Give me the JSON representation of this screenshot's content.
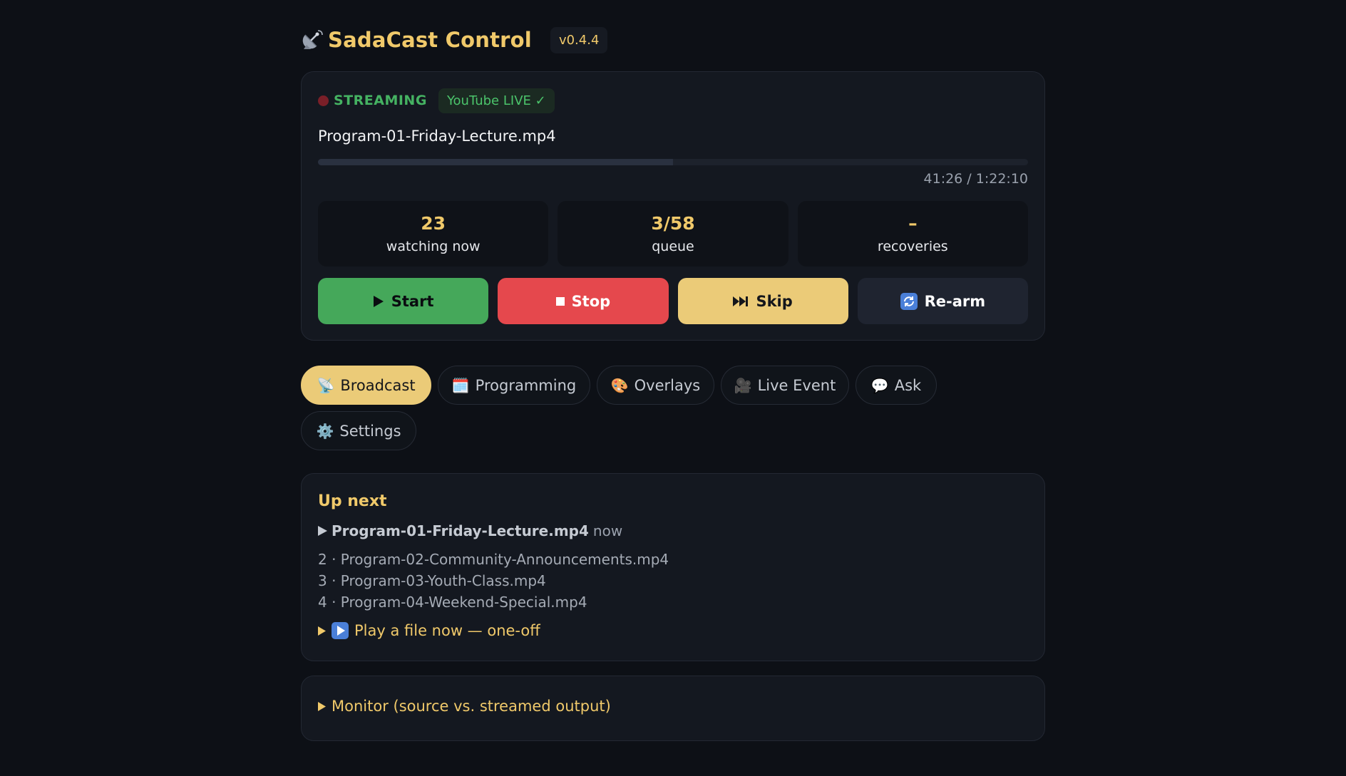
{
  "header": {
    "title": "SadaCast  Control",
    "version": "v0.4.4"
  },
  "status": {
    "state": "STREAMING",
    "badge": "YouTube LIVE ✓",
    "filename": "Program-01-Friday-Lecture.mp4",
    "progress_fraction": 0.5,
    "time": "41:26 / 1:22:10"
  },
  "stats": [
    {
      "value": "23",
      "label": "watching now"
    },
    {
      "value": "3/58",
      "label": "queue"
    },
    {
      "value": "–",
      "label": "recoveries"
    }
  ],
  "actions": {
    "start": "Start",
    "stop": "Stop",
    "skip": "Skip",
    "rearm": "Re-arm"
  },
  "tabs": [
    {
      "icon": "📡",
      "label": "Broadcast",
      "active": true
    },
    {
      "icon": "🗓️",
      "label": "Programming",
      "active": false
    },
    {
      "icon": "🎨",
      "label": "Overlays",
      "active": false
    },
    {
      "icon": "🎥",
      "label": "Live Event",
      "active": false
    },
    {
      "icon": "💬",
      "label": "Ask",
      "active": false
    },
    {
      "icon": "⚙️",
      "label": "Settings",
      "active": false
    }
  ],
  "upnext": {
    "title": "Up next",
    "now_name": "Program-01-Friday-Lecture.mp4",
    "now_tag": "now",
    "queue": [
      "2 · Program-02-Community-Announcements.mp4",
      "3 · Program-03-Youth-Class.mp4",
      "4 · Program-04-Weekend-Special.mp4"
    ],
    "play_now": "Play a file now — one-off"
  },
  "monitor": {
    "label": "Monitor (source vs. streamed output)"
  },
  "colors": {
    "accent": "#ebcb78",
    "streaming": "#45b262",
    "stop": "#e5484d",
    "start": "#45a85a"
  }
}
